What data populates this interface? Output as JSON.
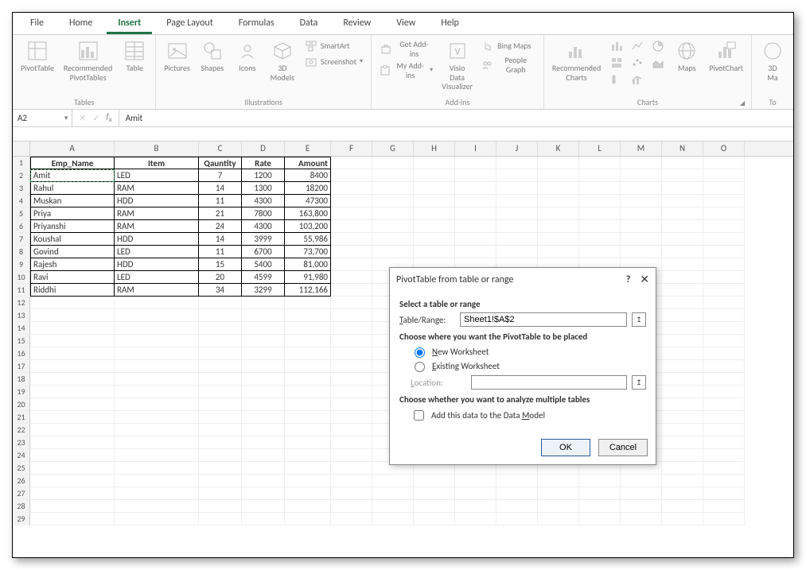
{
  "ribbon": {
    "tabs": [
      "File",
      "Home",
      "Insert",
      "Page Layout",
      "Formulas",
      "Data",
      "Review",
      "View",
      "Help"
    ],
    "active_tab": "Insert",
    "groups": {
      "tables": {
        "label": "Tables",
        "pivot_table": "PivotTable",
        "recommended_pivot": "Recommended\nPivotTables",
        "table": "Table"
      },
      "illustrations": {
        "label": "Illustrations",
        "pictures": "Pictures",
        "shapes": "Shapes",
        "icons": "Icons",
        "models": "3D\nModels",
        "smartart": "SmartArt",
        "screenshot": "Screenshot"
      },
      "addins": {
        "label": "Add-ins",
        "get": "Get Add-ins",
        "my": "My Add-ins",
        "visio": "Visio Data\nVisualizer",
        "bing": "Bing Maps",
        "people": "People Graph"
      },
      "charts": {
        "label": "Charts",
        "recommended": "Recommended\nCharts",
        "maps": "Maps",
        "pivotchart": "PivotChart"
      },
      "tours": {
        "label": "To",
        "map": "3D\nMa"
      }
    }
  },
  "namebox": "A2",
  "formula": "Amit",
  "columns": [
    "A",
    "B",
    "C",
    "D",
    "E",
    "F",
    "G",
    "H",
    "I",
    "J",
    "K",
    "L",
    "M",
    "N",
    "O"
  ],
  "table": {
    "headers": [
      "Emp_Name",
      "Item",
      "Qauntity",
      "Rate",
      "Amount"
    ],
    "rows": [
      [
        "Amit",
        "LED",
        "7",
        "1200",
        "8400"
      ],
      [
        "Rahul",
        "RAM",
        "14",
        "1300",
        "18200"
      ],
      [
        "Muskan",
        "HDD",
        "11",
        "4300",
        "47300"
      ],
      [
        "Priya",
        "RAM",
        "21",
        "7800",
        "163,800"
      ],
      [
        "Priyanshi",
        "RAM",
        "24",
        "4300",
        "103,200"
      ],
      [
        "Koushal",
        "HDD",
        "14",
        "3999",
        "55,986"
      ],
      [
        "Govind",
        "LED",
        "11",
        "6700",
        "73,700"
      ],
      [
        "Rajesh",
        "HDD",
        "15",
        "5400",
        "81,000"
      ],
      [
        "Ravi",
        "LED",
        "20",
        "4599",
        "91,980"
      ],
      [
        "Riddhi",
        "RAM",
        "34",
        "3299",
        "112,166"
      ]
    ]
  },
  "blank_rows": [
    12,
    13,
    14,
    15,
    16,
    17,
    18,
    19,
    20,
    21,
    22,
    23,
    24,
    25,
    26,
    27,
    28,
    29
  ],
  "dialog": {
    "title": "PivotTable from table or range",
    "section1": "Select a table or range",
    "range_label": "Table/Range:",
    "range_value": "Sheet1!$A$2",
    "section2": "Choose where you want the PivotTable to be placed",
    "opt_new": "New Worksheet",
    "opt_existing": "Existing Worksheet",
    "location_label": "Location:",
    "location_value": "",
    "section3": "Choose whether you want to analyze multiple tables",
    "chk_model": "Add this data to the Data Model",
    "ok": "OK",
    "cancel": "Cancel"
  }
}
